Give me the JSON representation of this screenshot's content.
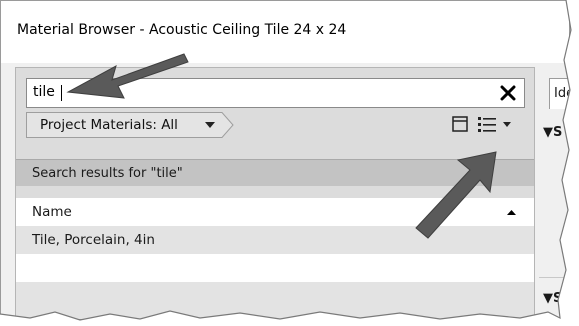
{
  "window": {
    "title": "Material Browser - Acoustic Ceiling Tile 24 x 24"
  },
  "search": {
    "value": "tile",
    "clear_icon": "close-icon"
  },
  "filter": {
    "label": "Project Materials: All",
    "dropdown_icon": "caret-down-icon"
  },
  "toolbar": {
    "view_toggle_icon": "panel-toggle-icon",
    "list_view_icon": "list-view-icon",
    "list_view_dropdown_icon": "caret-down-icon"
  },
  "results": {
    "header": "Search results for \"tile\"",
    "column_name": "Name",
    "sort_icon": "sort-up-icon",
    "rows": [
      {
        "name": "Tile, Porcelain, 4in"
      },
      {
        "name": ""
      },
      {
        "name": ""
      }
    ]
  },
  "right_panel": {
    "tab_label": "Ide",
    "section_1": "▼S",
    "section_2": "▼S"
  },
  "colors": {
    "panel_bg": "#dcdcdc",
    "header_bg": "#c3c3c3",
    "row_alt_bg": "#e3e3e3",
    "annotation_arrow": "#5a5a5a"
  }
}
